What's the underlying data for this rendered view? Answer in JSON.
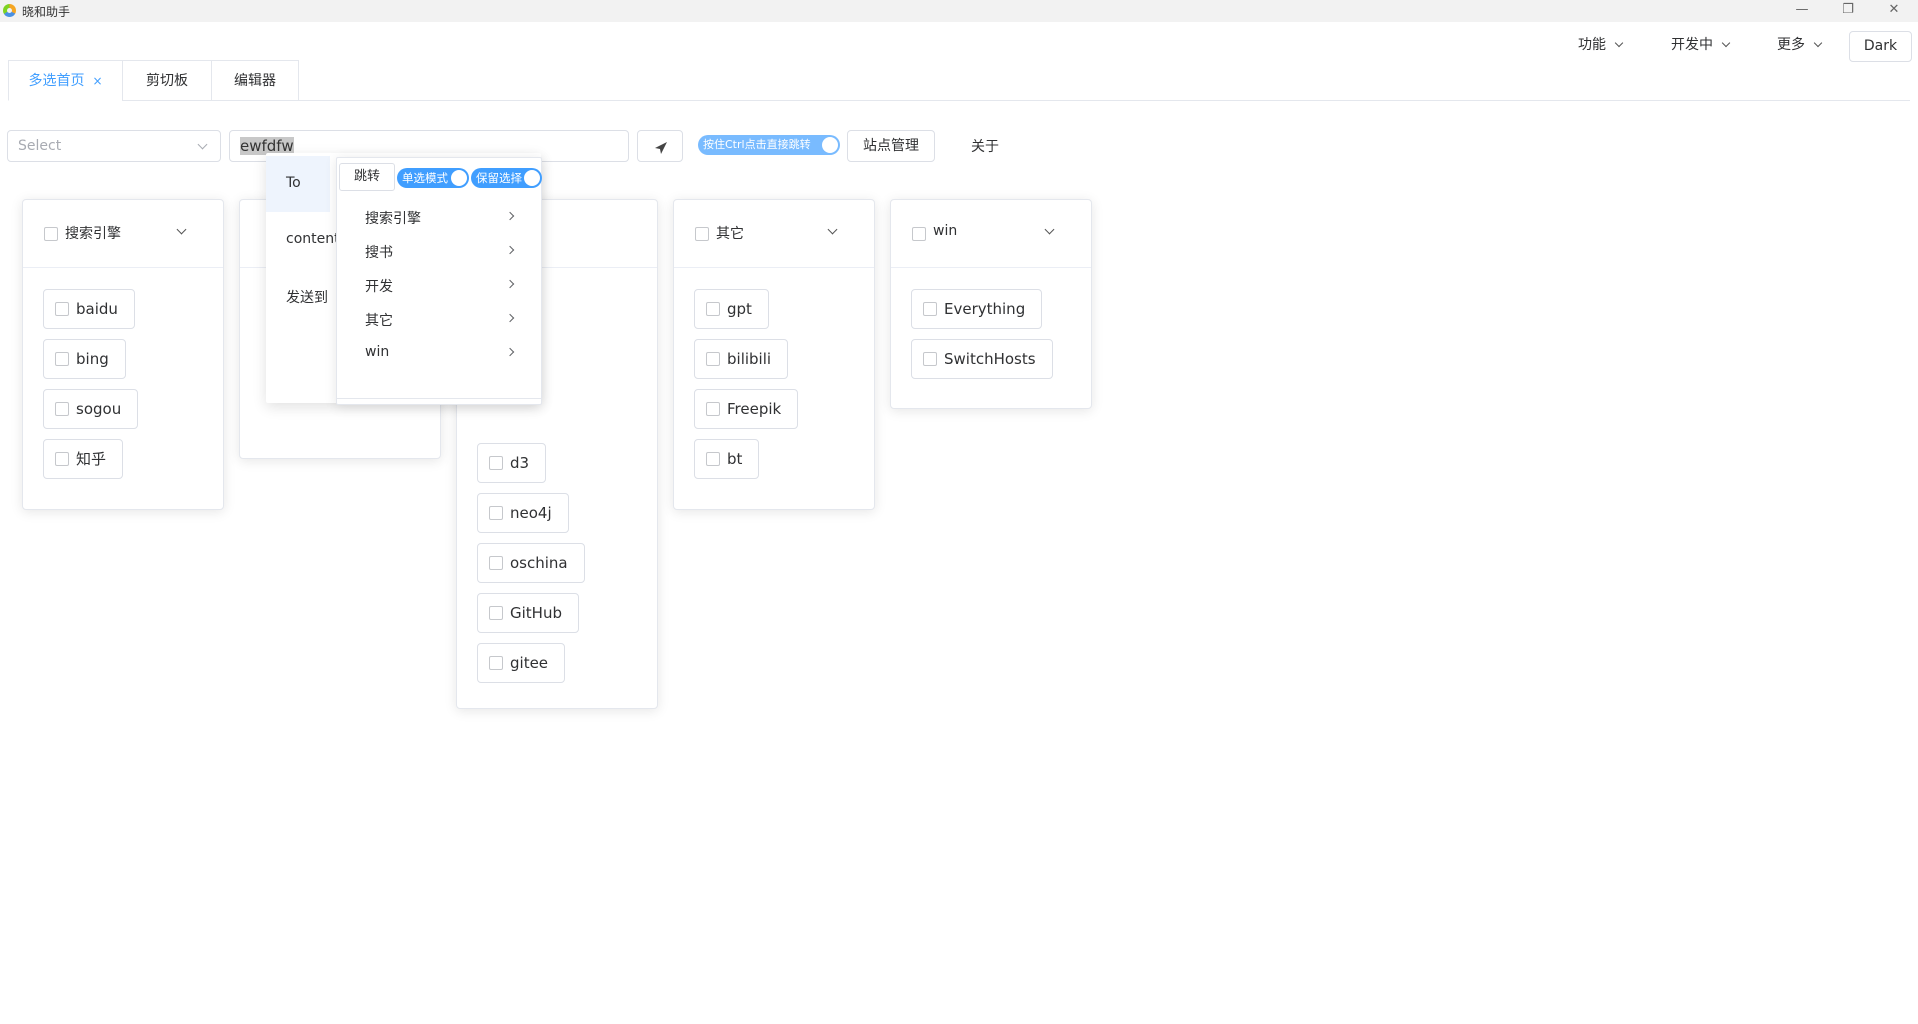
{
  "app": {
    "title": "晓和助手"
  },
  "window_controls": {
    "minimize": "—",
    "restore": "❐",
    "close": "✕"
  },
  "top_menu": {
    "func": "功能",
    "dev": "开发中",
    "more": "更多",
    "dark": "Dark"
  },
  "tabs": [
    {
      "label": "多选首页",
      "active": true,
      "close": "×"
    },
    {
      "label": "剪切板"
    },
    {
      "label": "编辑器"
    }
  ],
  "toolbar": {
    "select_placeholder": "Select",
    "input_value": "ewfdfw",
    "ctrl_switch_label": "按住Ctrl点击直接跳转",
    "site_manage": "站点管理",
    "about": "关于"
  },
  "cards": [
    {
      "title": "搜索引擎",
      "items": [
        "baidu",
        "bing",
        "sogou",
        "知乎"
      ]
    },
    {
      "title": "其它",
      "items": [
        "gpt",
        "bilibili",
        "Freepik",
        "bt"
      ]
    },
    {
      "title": "win",
      "items": [
        "Everything",
        "SwitchHosts"
      ]
    }
  ],
  "dev_card": {
    "items": [
      "d3",
      "neo4j",
      "oschina",
      "GitHub",
      "gitee"
    ]
  },
  "dropdown": {
    "left": [
      "To",
      "content",
      "发送到"
    ],
    "jump": "跳转",
    "single_mode": "单选模式",
    "keep_select": "保留选择",
    "items": [
      "搜索引擎",
      "搜书",
      "开发",
      "其它",
      "win"
    ]
  },
  "colors": {
    "accent": "#409eff",
    "switch_light": "#79bbff",
    "border": "#dcdfe6"
  }
}
